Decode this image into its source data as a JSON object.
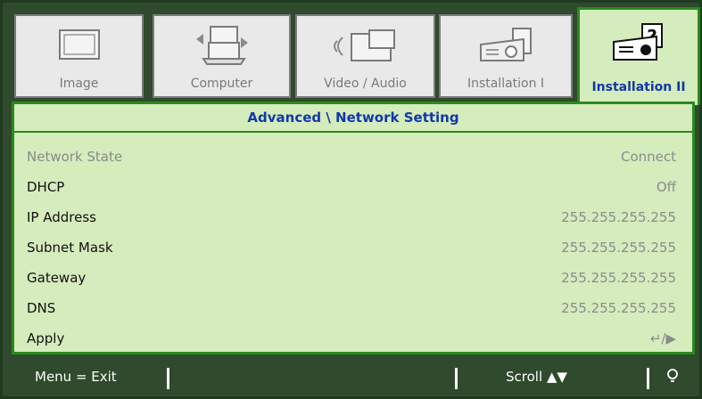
{
  "tabs": [
    {
      "label": "Image",
      "icon": "image-icon"
    },
    {
      "label": "Computer",
      "icon": "computer-icon"
    },
    {
      "label": "Video / Audio",
      "icon": "video-audio-icon"
    },
    {
      "label": "Installation I",
      "icon": "projector-icon"
    },
    {
      "label": "Installation II",
      "icon": "projector-question-icon",
      "active": true
    }
  ],
  "panel": {
    "title": "Advanced \\ Network Setting",
    "rows": [
      {
        "label": "Network State",
        "value": "Connect",
        "disabled": true
      },
      {
        "label": "DHCP",
        "value": "Off"
      },
      {
        "label": "IP Address",
        "value": "255.255.255.255"
      },
      {
        "label": "Subnet Mask",
        "value": "255.255.255.255"
      },
      {
        "label": "Gateway",
        "value": "255.255.255.255"
      },
      {
        "label": "DNS",
        "value": "255.255.255.255"
      },
      {
        "label": "Apply",
        "value": "↵/▶"
      }
    ]
  },
  "bottom": {
    "menu_exit": "Menu = Exit",
    "scroll": "Scroll ▲▼",
    "lamp_icon": "lightbulb-icon"
  }
}
